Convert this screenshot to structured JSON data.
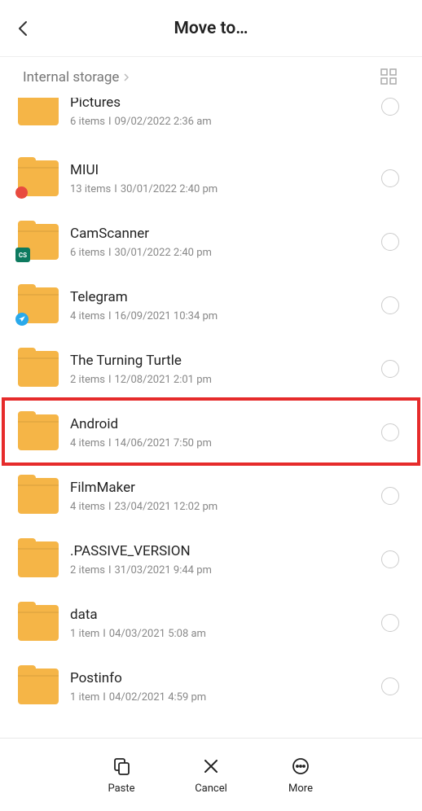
{
  "header": {
    "title": "Move to…"
  },
  "breadcrumb": {
    "text": "Internal storage"
  },
  "folders": [
    {
      "name": "Pictures",
      "items": "6 items",
      "date": "09/02/2022 2:36 am",
      "badge": null,
      "first": true,
      "highlighted": false
    },
    {
      "name": "MIUI",
      "items": "13 items",
      "date": "30/01/2022 2:40 pm",
      "badge": "miui",
      "first": false,
      "highlighted": false
    },
    {
      "name": "CamScanner",
      "items": "6 items",
      "date": "30/01/2022 2:40 pm",
      "badge": "cam",
      "first": false,
      "highlighted": false
    },
    {
      "name": "Telegram",
      "items": "4 items",
      "date": "16/09/2021 10:34 pm",
      "badge": "telegram",
      "first": false,
      "highlighted": false
    },
    {
      "name": "The Turning Turtle",
      "items": "2 items",
      "date": "12/08/2021 2:01 pm",
      "badge": null,
      "first": false,
      "highlighted": false
    },
    {
      "name": "Android",
      "items": "4 items",
      "date": "14/06/2021 7:50 pm",
      "badge": null,
      "first": false,
      "highlighted": true
    },
    {
      "name": "FilmMaker",
      "items": "4 items",
      "date": "23/04/2021 12:02 pm",
      "badge": null,
      "first": false,
      "highlighted": false
    },
    {
      "name": ".PASSIVE_VERSION",
      "items": "2 items",
      "date": "31/03/2021 9:44 pm",
      "badge": null,
      "first": false,
      "highlighted": false
    },
    {
      "name": "data",
      "items": "1 item",
      "date": "04/03/2021 5:08 am",
      "badge": null,
      "first": false,
      "highlighted": false
    },
    {
      "name": "Postinfo",
      "items": "1 item",
      "date": "04/02/2021 4:59 pm",
      "badge": null,
      "first": false,
      "highlighted": false
    }
  ],
  "bottom": {
    "paste": "Paste",
    "cancel": "Cancel",
    "more": "More"
  },
  "badge_labels": {
    "cam": "CS"
  }
}
